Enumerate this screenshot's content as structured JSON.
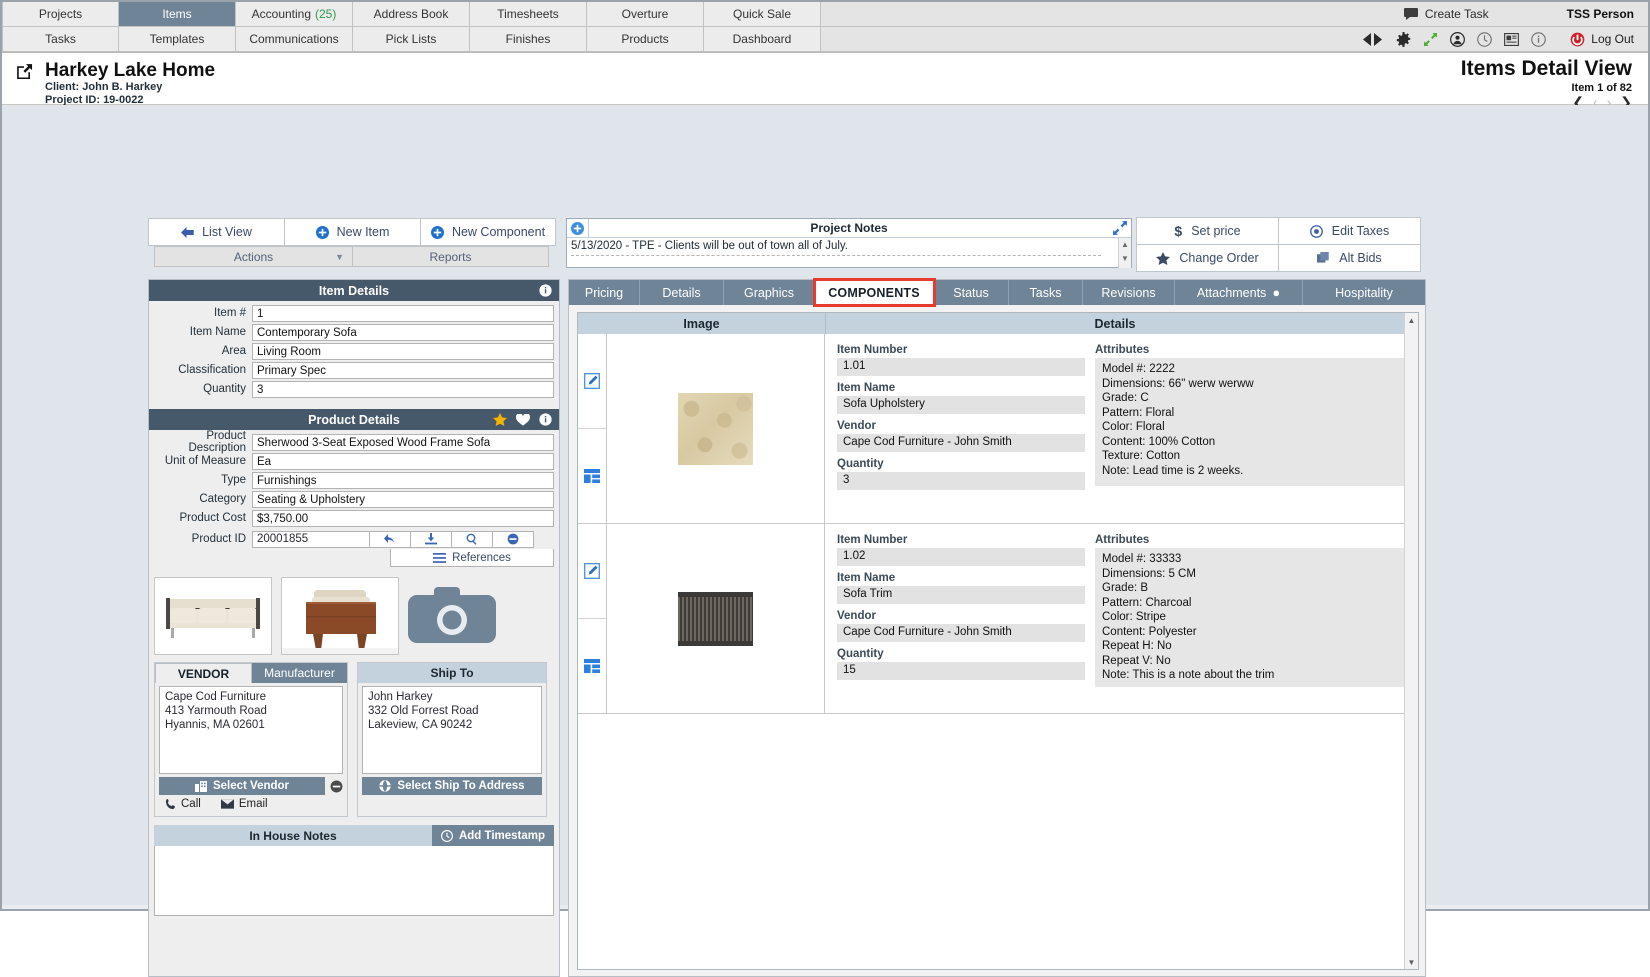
{
  "topnav": {
    "row1": [
      {
        "label": "Projects",
        "active": false
      },
      {
        "label": "Items",
        "active": true
      },
      {
        "label": "Accounting",
        "badge": "(25)",
        "active": false
      },
      {
        "label": "Address Book",
        "active": false
      },
      {
        "label": "Timesheets",
        "active": false
      },
      {
        "label": "Overture",
        "active": false
      },
      {
        "label": "Quick Sale",
        "active": false
      }
    ],
    "row2": [
      {
        "label": "Tasks"
      },
      {
        "label": "Templates"
      },
      {
        "label": "Communications"
      },
      {
        "label": "Pick Lists"
      },
      {
        "label": "Finishes"
      },
      {
        "label": "Products"
      },
      {
        "label": "Dashboard"
      }
    ],
    "create_task": "Create Task",
    "user": "TSS Person",
    "logout": "Log Out"
  },
  "project_header": {
    "title": "Harkey Lake Home",
    "client": "Client: John B. Harkey",
    "project_id": "Project ID: 19-0022",
    "view_title": "Items Detail View",
    "item_counter": "Item 1 of 82"
  },
  "toolbar": {
    "list_view": "List View",
    "new_item": "New Item",
    "new_component": "New Component",
    "actions": "Actions",
    "reports": "Reports"
  },
  "project_notes": {
    "title": "Project Notes",
    "entry": "5/13/2020 - TPE - Clients will be out of town all of July."
  },
  "right_actions": {
    "set_price": "Set price",
    "edit_taxes": "Edit Taxes",
    "change_order": "Change Order",
    "alt_bids": "Alt Bids"
  },
  "item_details": {
    "title": "Item Details",
    "fields": [
      {
        "label": "Item #",
        "value": "1"
      },
      {
        "label": "Item Name",
        "value": "Contemporary Sofa"
      },
      {
        "label": "Area",
        "value": "Living Room"
      },
      {
        "label": "Classification",
        "value": "Primary Spec"
      },
      {
        "label": "Quantity",
        "value": "3"
      }
    ]
  },
  "product_details": {
    "title": "Product Details",
    "fields": [
      {
        "label": "Product Description",
        "value": "Sherwood 3-Seat Exposed Wood Frame Sofa"
      },
      {
        "label": "Unit of Measure",
        "value": "Ea"
      },
      {
        "label": "Type",
        "value": "Furnishings"
      },
      {
        "label": "Category",
        "value": "Seating & Upholstery"
      },
      {
        "label": "Product Cost",
        "value": "$3,750.00"
      }
    ],
    "product_id_label": "Product ID",
    "product_id_value": "20001855",
    "references": "References"
  },
  "vendor": {
    "tab_vendor": "VENDOR",
    "tab_manufacturer": "Manufacturer",
    "address": "Cape Cod Furniture\n413 Yarmouth Road\nHyannis, MA 02601",
    "select_button": "Select Vendor",
    "call": "Call",
    "email": "Email"
  },
  "ship_to": {
    "title": "Ship To",
    "address": "John Harkey\n332 Old Forrest Road\nLakeview, CA 90242",
    "select_button": "Select Ship To Address"
  },
  "in_house_notes": {
    "title": "In House Notes",
    "add_timestamp": "Add Timestamp",
    "body": ""
  },
  "right_tabs": [
    {
      "label": "Pricing",
      "selected": false
    },
    {
      "label": "Details",
      "selected": false
    },
    {
      "label": "Graphics",
      "selected": false
    },
    {
      "label": "COMPONENTS",
      "selected": true
    },
    {
      "label": "Status",
      "selected": false
    },
    {
      "label": "Tasks",
      "selected": false
    },
    {
      "label": "Revisions",
      "selected": false
    },
    {
      "label": "Attachments",
      "selected": false,
      "dot": true
    },
    {
      "label": "Hospitality",
      "selected": false
    }
  ],
  "components_grid": {
    "col_image": "Image",
    "col_details": "Details",
    "labels": {
      "item_number": "Item Number",
      "item_name": "Item Name",
      "vendor": "Vendor",
      "quantity": "Quantity",
      "attributes": "Attributes"
    },
    "rows": [
      {
        "item_number": "1.01",
        "item_name": "Sofa Upholstery",
        "vendor": "Cape Cod Furniture - John Smith",
        "quantity": "3",
        "attributes": [
          "Model #: 2222",
          "Dimensions: 66\" werw werww",
          "Grade: C",
          "Pattern: Floral",
          "Color: Floral",
          "Content: 100% Cotton",
          "Texture: Cotton",
          "Note: Lead time is 2 weeks."
        ],
        "swatch_kind": "floral-beige"
      },
      {
        "item_number": "1.02",
        "item_name": "Sofa Trim",
        "vendor": "Cape Cod Furniture - John Smith",
        "quantity": "15",
        "attributes": [
          "Model #: 33333",
          "Dimensions: 5 CM",
          "Grade: B",
          "Pattern: Charcoal",
          "Color: Stripe",
          "Content: Polyester",
          "Repeat H: No",
          "Repeat V: No",
          "Note: This is a note about the trim"
        ],
        "swatch_kind": "charcoal-stripe"
      }
    ]
  },
  "colors": {
    "header_dark": "#46596b",
    "accent_blue": "#3b66b5",
    "tab_bar": "#6f8496",
    "selected_tab_outline": "#e8392d",
    "badge_green": "#2e9b4e",
    "logout_red": "#d41f26",
    "star_gold": "#f4b400"
  }
}
